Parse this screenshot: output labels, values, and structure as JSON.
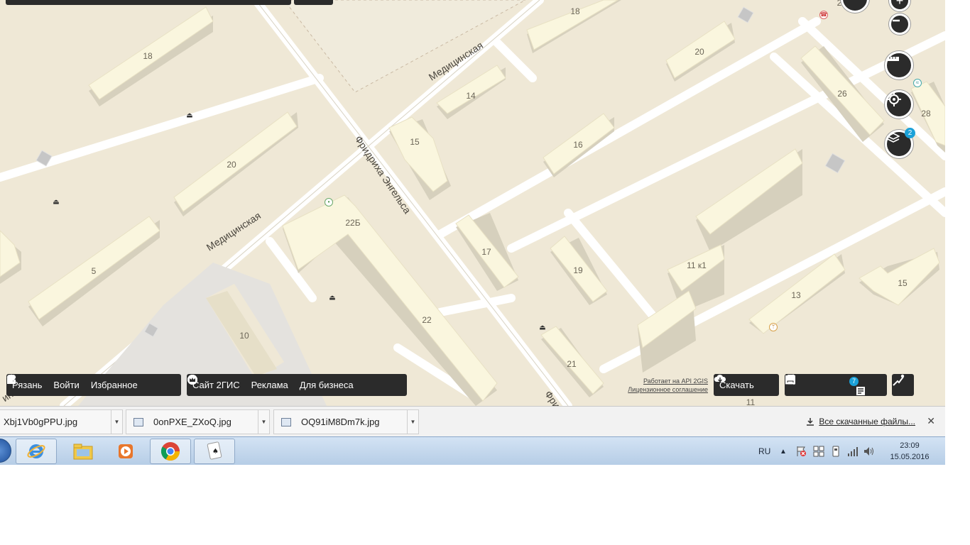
{
  "map": {
    "streets": {
      "medicinskaya_top": "Медицинская",
      "medicinskaya_left": "Медицинская",
      "engelsa": "Фридриха Энгельса",
      "engelsa_short": "Фри",
      "partial_left": "ина"
    },
    "buildings": [
      "18",
      "20",
      "5",
      "14",
      "15",
      "16",
      "17",
      "19",
      "22Б",
      "22",
      "10",
      "21",
      "18",
      "20",
      "26",
      "28",
      "11 к1",
      "13",
      "15",
      "11",
      "2"
    ],
    "controls": {
      "layers_badge": "2"
    }
  },
  "left_bar": {
    "city": "Рязань",
    "login": "Войти",
    "favorites": "Избранное"
  },
  "middle_bar": {
    "site": "Сайт 2ГИС",
    "ads": "Реклама",
    "business": "Для бизнеса"
  },
  "credits": {
    "api": "Работает на API 2GIS",
    "license": "Лицензионное соглашение"
  },
  "right_bar": {
    "download": "Скачать",
    "news_badge": "7"
  },
  "downloads": {
    "items": [
      {
        "name": "Xbj1Vb0gPPU.jpg"
      },
      {
        "name": "0onPXE_ZXoQ.jpg"
      },
      {
        "name": "OQ91iM8Dm7k.jpg"
      }
    ],
    "all_label": "Все скачанные файлы...",
    "close": "✕"
  },
  "taskbar": {
    "lang": "RU",
    "time": "23:09",
    "date": "15.05.2016",
    "icons": [
      "ie-icon",
      "explorer-icon",
      "media-player-icon",
      "chrome-icon",
      "solitaire-icon"
    ]
  }
}
